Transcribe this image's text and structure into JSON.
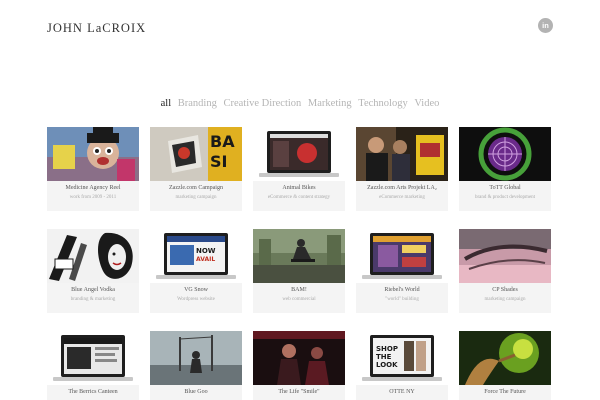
{
  "header": {
    "site_title": "JOHN LaCROIX",
    "social_label": "in"
  },
  "filters": [
    {
      "label": "all",
      "active": true
    },
    {
      "label": "Branding",
      "active": false
    },
    {
      "label": "Creative Direction",
      "active": false
    },
    {
      "label": "Marketing",
      "active": false
    },
    {
      "label": "Technology",
      "active": false
    },
    {
      "label": "Video",
      "active": false
    }
  ],
  "portfolio": {
    "rows": [
      [
        {
          "title": "Medicine Agency Reel",
          "subtitle": "work from 2009 - 2011"
        },
        {
          "title": "Zazzle.com Campaign",
          "subtitle": "marketing campaign"
        },
        {
          "title": "Animal Bikes",
          "subtitle": "eCommerce & content strategy"
        },
        {
          "title": "Zazzle.com Arts Projekt LA₂",
          "subtitle": "eCommerce marketing"
        },
        {
          "title": "ToTT Global",
          "subtitle": "brand & product development"
        }
      ],
      [
        {
          "title": "Blue Angel Vodka",
          "subtitle": "branding & marketing"
        },
        {
          "title": "VG Snow",
          "subtitle": "Wordpress website"
        },
        {
          "title": "BAM!",
          "subtitle": "web commercial"
        },
        {
          "title": "Riebel's World",
          "subtitle": "\"world\" building"
        },
        {
          "title": "CP Shades",
          "subtitle": "marketing campaign"
        }
      ],
      [
        {
          "title": "The Berrics Canteen",
          "subtitle": ""
        },
        {
          "title": "Blue Goo",
          "subtitle": ""
        },
        {
          "title": "The Life \"Smile\"",
          "subtitle": ""
        },
        {
          "title": "OTTE NY",
          "subtitle": ""
        },
        {
          "title": "Force The Future",
          "subtitle": ""
        }
      ]
    ]
  },
  "colors": {
    "background": "#ffffff",
    "title_text": "#333333",
    "filter_inactive": "#b5b5b5",
    "filter_active": "#222222",
    "card_background": "#f4f4f4",
    "social_icon": "#b3b3b3"
  }
}
